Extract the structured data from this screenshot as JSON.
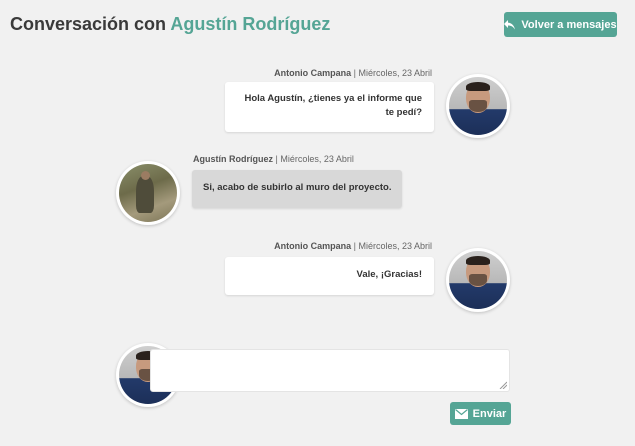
{
  "header": {
    "title_prefix": "Conversación con",
    "title_name": "Agustín Rodríguez",
    "back_button": "Volver a mensajes",
    "back_icon": "reply-arrow-icon"
  },
  "messages": [
    {
      "author": "Antonio Campana",
      "separator": "|",
      "date": "Miércoles, 23 Abril",
      "text": "Hola Agustín, ¿tienes ya el informe que te pedí?",
      "side": "right"
    },
    {
      "author": "Agustín Rodríguez",
      "separator": "|",
      "date": "Miércoles, 23 Abril",
      "text": "Si, acabo de subirlo al muro del proyecto.",
      "side": "left"
    },
    {
      "author": "Antonio Campana",
      "separator": "|",
      "date": "Miércoles, 23 Abril",
      "text": "Vale, ¡Gracias!",
      "side": "right"
    }
  ],
  "composer": {
    "value": "",
    "send_button": "Enviar",
    "send_icon": "envelope-icon"
  },
  "colors": {
    "accent": "#55a595",
    "background": "#f1f1f1",
    "bubble_own": "#ffffff",
    "bubble_other": "#d8d8d8"
  }
}
